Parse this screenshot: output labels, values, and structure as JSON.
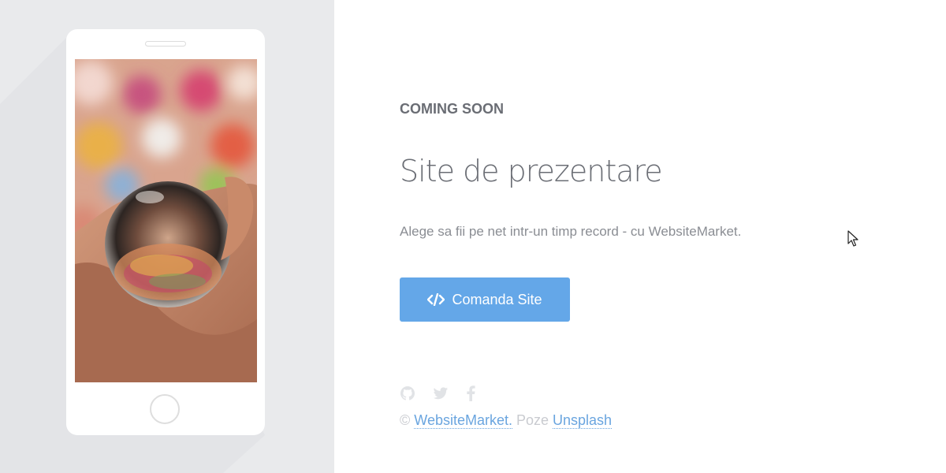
{
  "hero": {
    "eyebrow": "COMING SOON",
    "title": "Site de prezentare",
    "lead": "Alege sa fii pe net intr-un timp record - cu WebsiteMarket.",
    "cta_label": "Comanda Site"
  },
  "social": {
    "icons": [
      "github-icon",
      "twitter-icon",
      "facebook-icon"
    ]
  },
  "footer": {
    "copyright": "©",
    "brand_link": "WebsiteMarket.",
    "photos_text": " Poze ",
    "photos_link": "Unsplash"
  },
  "colors": {
    "accent": "#64a7e8",
    "link": "#6aa5df",
    "panel_bg": "#e9eaec",
    "text": "#6b6e75"
  }
}
